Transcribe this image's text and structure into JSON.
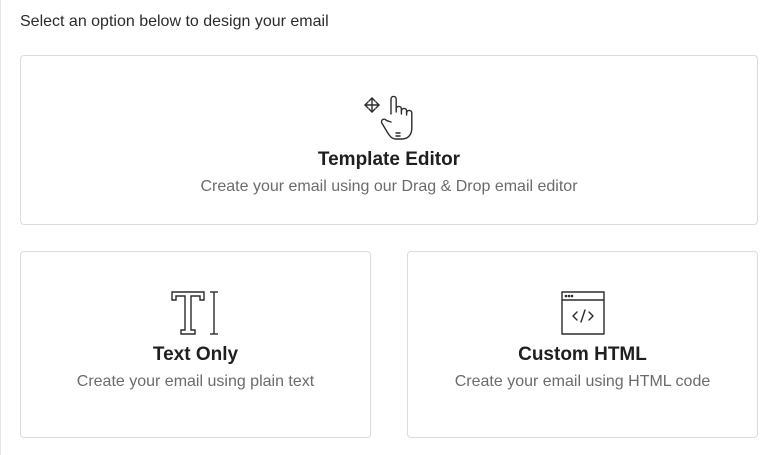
{
  "intro_text": "Select an option below to design your email",
  "options": [
    {
      "title": "Template Editor",
      "description": "Create your email using our Drag & Drop email editor",
      "icon": "drag-drop-hand-icon"
    },
    {
      "title": "Text Only",
      "description": "Create your email using plain text",
      "icon": "text-cursor-icon"
    },
    {
      "title": "Custom HTML",
      "description": "Create your email using HTML code",
      "icon": "code-window-icon"
    }
  ],
  "colors": {
    "card_border": "#d9dbde",
    "title": "#1f1f1f",
    "description": "#6b6b6b",
    "icon_stroke": "#2b2b2b"
  }
}
